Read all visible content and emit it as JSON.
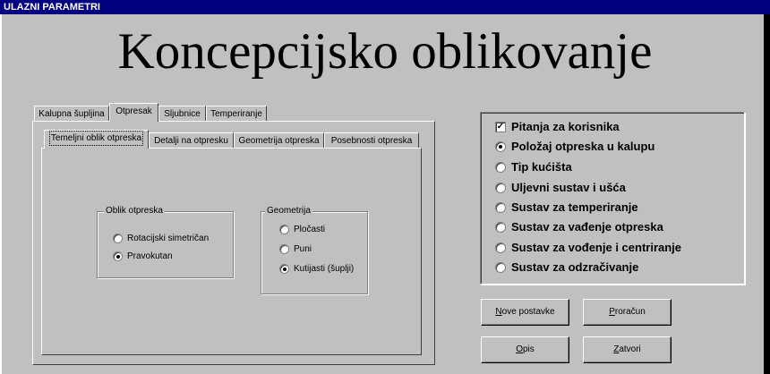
{
  "window": {
    "title": "ULAZNI PARAMETRI"
  },
  "heading": "Koncepcijsko oblikovanje",
  "outer_tabs": [
    {
      "label": "Kalupna šupljina"
    },
    {
      "label": "Otpresak",
      "active": true
    },
    {
      "label": "Sljubnice"
    },
    {
      "label": "Temperiranje"
    }
  ],
  "inner_tabs": [
    {
      "label": "Temeljni oblik otpreska",
      "active": true
    },
    {
      "label": "Detalji na otpresku"
    },
    {
      "label": "Geometrija otpreska"
    },
    {
      "label": "Posebnosti otpreska"
    }
  ],
  "oblik": {
    "title": "Oblik otpreska",
    "options": [
      {
        "label": "Rotacijski simetričan",
        "selected": false
      },
      {
        "label": "Pravokutan",
        "selected": true
      }
    ]
  },
  "geometrija": {
    "title": "Geometrija",
    "options": [
      {
        "label": "Pločasti",
        "selected": false
      },
      {
        "label": "Puni",
        "selected": false
      },
      {
        "label": "Kutijasti (šuplji)",
        "selected": true
      }
    ]
  },
  "right_panel": {
    "checkbox": {
      "label": "Pitanja za korisnika",
      "checked": true
    },
    "options": [
      {
        "label": "Položaj otpreska u kalupu",
        "selected": true
      },
      {
        "label": "Tip kućišta",
        "selected": false
      },
      {
        "label": "Uljevni sustav i ušća",
        "selected": false
      },
      {
        "label": "Sustav za temperiranje",
        "selected": false
      },
      {
        "label": "Sustav za vađenje otpreska",
        "selected": false
      },
      {
        "label": "Sustav za vođenje i centriranje",
        "selected": false
      },
      {
        "label": "Sustav za odzračivanje",
        "selected": false
      }
    ]
  },
  "buttons": {
    "nove_postavke": {
      "first": "N",
      "rest": "ove postavke"
    },
    "proracun": {
      "first": "P",
      "rest": "roračun"
    },
    "opis": {
      "first": "O",
      "rest": "pis"
    },
    "zatvori": {
      "first": "Z",
      "rest": "atvori"
    }
  }
}
